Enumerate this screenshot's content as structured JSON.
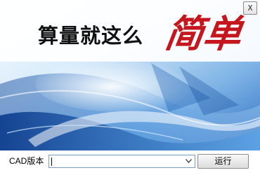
{
  "banner": {
    "slogan_main": "算量就这么",
    "slogan_accent": "简单"
  },
  "window": {
    "close_label": "X"
  },
  "footer": {
    "cad_version_label": "CAD版本",
    "cad_version_value": "",
    "run_label": "运行"
  },
  "icons": {
    "close": "close-icon",
    "dropdown": "chevron-down-icon"
  },
  "colors": {
    "accent_red": "#c4161c",
    "banner_blue": "#1f63b8",
    "banner_light": "#e8f3fc"
  }
}
